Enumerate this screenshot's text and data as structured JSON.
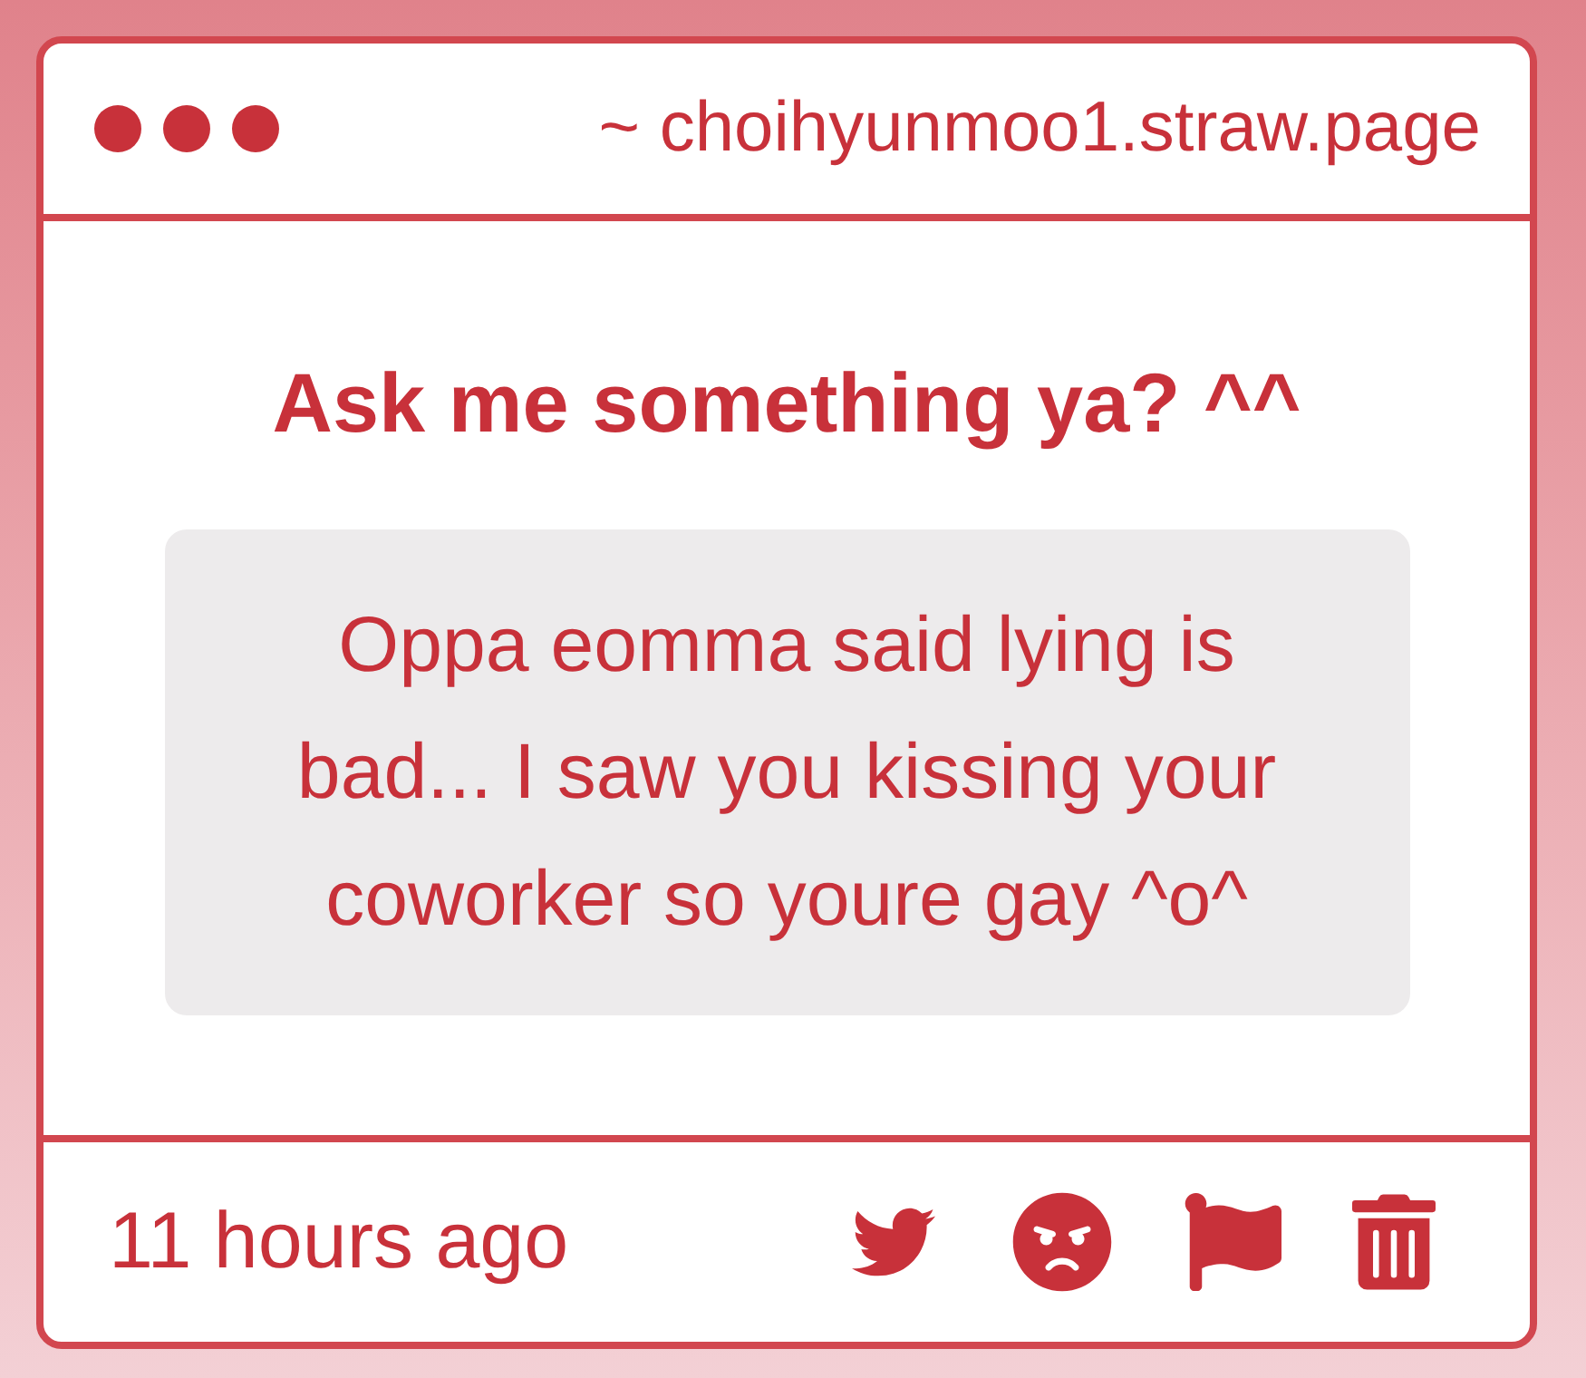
{
  "window": {
    "address": "~ choihyunmoo1.straw.page"
  },
  "question": {
    "prompt": "Ask me something ya? ^^",
    "message": "Oppa eomma said lying is bad... I saw you kissing your coworker so youre gay ^o^"
  },
  "footer": {
    "time": "11 hours ago"
  }
}
